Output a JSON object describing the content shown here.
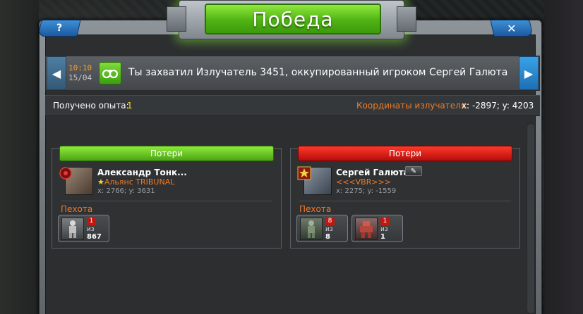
{
  "title": "Победа",
  "help_label": "?",
  "close_label": "✕",
  "banner": {
    "time": "10:10",
    "date": "15/04",
    "message": "Ты захватил Излучатель 3451, оккупированный игроком Сергей Галюта"
  },
  "info": {
    "exp_label": "Получено опыта:",
    "exp_value": "1",
    "coord_label": "Координаты излучателя:",
    "coord_value": "x: -2897; y: 4203"
  },
  "left_side": {
    "loss_label": "Потери",
    "player_name": "Александр Тонк...",
    "alliance_star": "★",
    "alliance": "Альянс TRIBUNAL",
    "coords": "x: 2766; y: 3631",
    "section": "Пехота",
    "units": [
      {
        "loss": "1",
        "of": "из",
        "total": "867"
      }
    ]
  },
  "right_side": {
    "loss_label": "Потери",
    "player_name": "Сергей Галюта",
    "alliance": "<<<VBR>>>",
    "coords": "x: 2275; y: -1559",
    "section": "Пехота",
    "units": [
      {
        "loss": "8",
        "of": "из",
        "total": "8"
      },
      {
        "loss": "1",
        "of": "из",
        "total": "1"
      }
    ]
  },
  "colors": {
    "win_green": "#4fb313",
    "loss_red": "#c4160f",
    "accent_orange": "#f07a25",
    "exp_yellow": "#f3dc2a"
  }
}
